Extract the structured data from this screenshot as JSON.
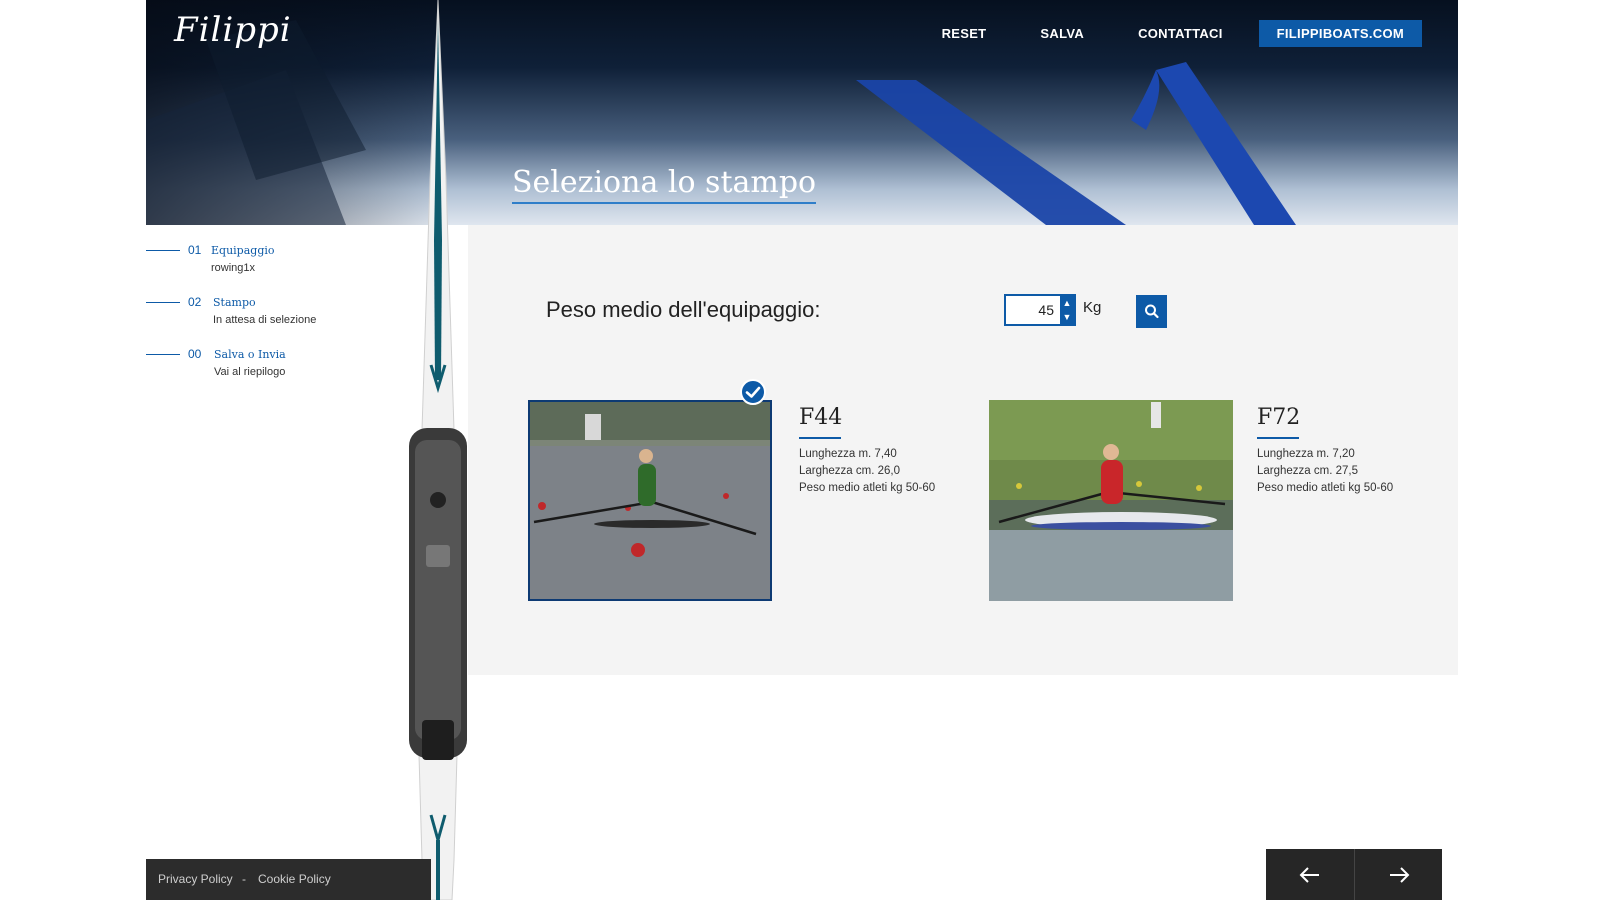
{
  "header": {
    "logo_text": "Filippi",
    "nav": [
      "RESET",
      "SALVA",
      "CONTATTACI"
    ],
    "cta": "FILIPPIBOATS.COM"
  },
  "hero": {
    "title": "Seleziona lo stampo"
  },
  "steps": [
    {
      "num": "01",
      "title": "Equipaggio",
      "sub": "rowing1x"
    },
    {
      "num": "02",
      "title": "Stampo",
      "sub": "In attesa di selezione"
    },
    {
      "num": "00",
      "title": "Salva o Invia",
      "sub": "Vai al riepilogo"
    }
  ],
  "weight": {
    "label": "Peso medio dell'equipaggio:",
    "value": "45",
    "unit": "Kg"
  },
  "boats": [
    {
      "name": "F44",
      "length": "Lunghezza m. 7,40",
      "width": "Larghezza cm. 26,0",
      "weight": "Peso medio atleti kg 50-60",
      "selected": true
    },
    {
      "name": "F72",
      "length": "Lunghezza m. 7,20",
      "width": "Larghezza cm. 27,5",
      "weight": "Peso medio atleti kg 50-60",
      "selected": false
    }
  ],
  "footer": {
    "privacy": "Privacy Policy",
    "separator": "-",
    "cookie": "Cookie Policy"
  },
  "colors": {
    "accent": "#0d5aa7",
    "dark": "#262626",
    "content_bg": "#f4f4f4"
  },
  "icons": [
    "search-icon",
    "check-icon",
    "arrow-left-icon",
    "arrow-right-icon",
    "spin-up-icon",
    "spin-down-icon"
  ]
}
